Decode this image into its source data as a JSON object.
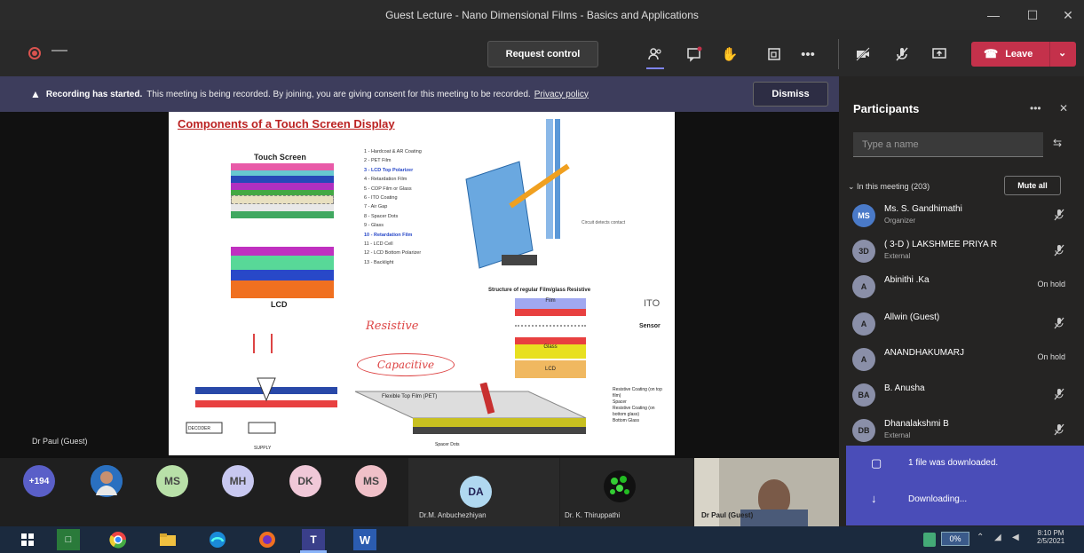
{
  "window": {
    "title": "Guest Lecture - Nano Dimensional Films - Basics and Applications"
  },
  "toolbar": {
    "request_control": "Request control",
    "leave": "Leave"
  },
  "banner": {
    "strong": "Recording has started.",
    "text": "This meeting is being recorded. By joining, you are giving consent for this meeting to be recorded.",
    "link": "Privacy policy",
    "dismiss": "Dismiss"
  },
  "slide": {
    "title": "Components of a Touch Screen Display",
    "touch_label": "Touch Screen",
    "lcd_label": "LCD",
    "layers": [
      "1 - Hardcoat & AR Coating",
      "2 - PET Film",
      "3 - LCD Top Polarizer",
      "4 - Retardation Film",
      "5 - COP Film or Glass",
      "6 - ITO Coating",
      "7 - Air Gap",
      "8 - Spacer Dots",
      "9 - Glass",
      "10 - Retardation Film",
      "11 - LCD Cell",
      "12 - LCD Bottom Polarizer",
      "13 - Backlight"
    ],
    "resistive_title": "Structure of regular Film/glass Resistive",
    "ito": "ITO",
    "sensor": "Sensor",
    "film": "Film",
    "glass": "Glass",
    "lcd_small": "LCD",
    "pet_label": "Flexible Top Film (PET)",
    "spacer_dots": "Spacer Dots",
    "res_coat_top": "Resistive Coating (on top film)",
    "spacer": "Spacer",
    "res_coat_bottom": "Resistive Coating (on bottom glass)",
    "bottom_glass": "Bottom Glass",
    "hw1": "Resistive",
    "hw2": "Capacitive",
    "pen": "pen",
    "supply": "SUPPLY",
    "decoder": "DECODER"
  },
  "presenter": "Dr Paul (Guest)",
  "panel": {
    "title": "Participants",
    "search_placeholder": "Type a name",
    "section": "In this meeting (203)",
    "mute_all": "Mute all",
    "people": [
      {
        "initials": "MS",
        "name": "Ms. S. Gandhimathi",
        "sub": "Organizer",
        "status": "mic-off"
      },
      {
        "initials": "3D",
        "name": "( 3-D ) LAKSHMEE PRIYA R",
        "sub": "External",
        "status": "mic-off"
      },
      {
        "initials": "A",
        "name": "Abinithi .Ka",
        "sub": "",
        "status": "On hold"
      },
      {
        "initials": "A",
        "name": "Allwin (Guest)",
        "sub": "",
        "status": "mic-off"
      },
      {
        "initials": "A",
        "name": "ANANDHAKUMARJ",
        "sub": "",
        "status": "On hold"
      },
      {
        "initials": "BA",
        "name": "B. Anusha",
        "sub": "",
        "status": "mic-off"
      },
      {
        "initials": "DB",
        "name": "Dhanalakshmi B",
        "sub": "External",
        "status": "mic-off"
      }
    ]
  },
  "notification": {
    "downloaded": "1 file was downloaded.",
    "downloading": "Downloading..."
  },
  "strip": {
    "count": "+194",
    "tiles": [
      "MS",
      "MH",
      "DK",
      "MS"
    ],
    "da": "DA",
    "label_da": "Dr.M. Anbuchezhiyan",
    "label_kt": "Dr. K. Thiruppathi",
    "label_self": "Dr Paul (Guest)"
  },
  "taskbar": {
    "battery": "0%",
    "time": "8:10 PM",
    "date": "2/5/2021"
  },
  "colors": {
    "leave": "#c4314b",
    "banner": "#3d3d5c",
    "notif": "#4a4db8",
    "accent": "#6264a7"
  }
}
